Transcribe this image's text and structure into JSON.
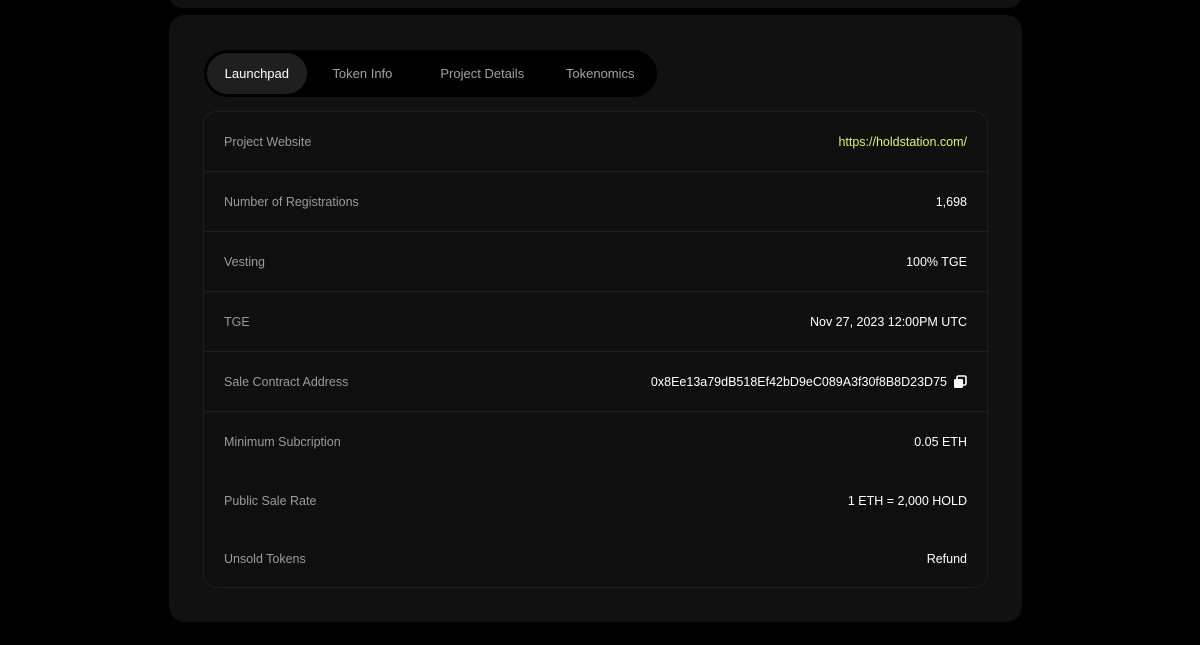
{
  "tabs": [
    {
      "label": "Launchpad",
      "active": true
    },
    {
      "label": "Token Info",
      "active": false
    },
    {
      "label": "Project Details",
      "active": false
    },
    {
      "label": "Tokenomics",
      "active": false
    }
  ],
  "details": {
    "website": {
      "label": "Project Website",
      "value": "https://holdstation.com/"
    },
    "registrations": {
      "label": "Number of Registrations",
      "value": "1,698"
    },
    "vesting": {
      "label": "Vesting",
      "value": "100% TGE"
    },
    "tge": {
      "label": "TGE",
      "value": "Nov 27, 2023 12:00PM UTC"
    },
    "contract": {
      "label": "Sale Contract Address",
      "value": "0x8Ee13a79dB518Ef42bD9eC089A3f30f8B8D23D75",
      "icon": "copy-icon"
    },
    "min_subscription": {
      "label": "Minimum Subcription",
      "value": "0.05 ETH"
    },
    "sale_rate": {
      "label": "Public Sale Rate",
      "value": "1 ETH = 2,000 HOLD"
    },
    "unsold": {
      "label": "Unsold Tokens",
      "value": "Refund"
    }
  },
  "colors": {
    "background": "#000000",
    "card": "#111111",
    "link_accent": "#d4f56a",
    "label": "#9a9a9a",
    "value": "#ffffff"
  }
}
